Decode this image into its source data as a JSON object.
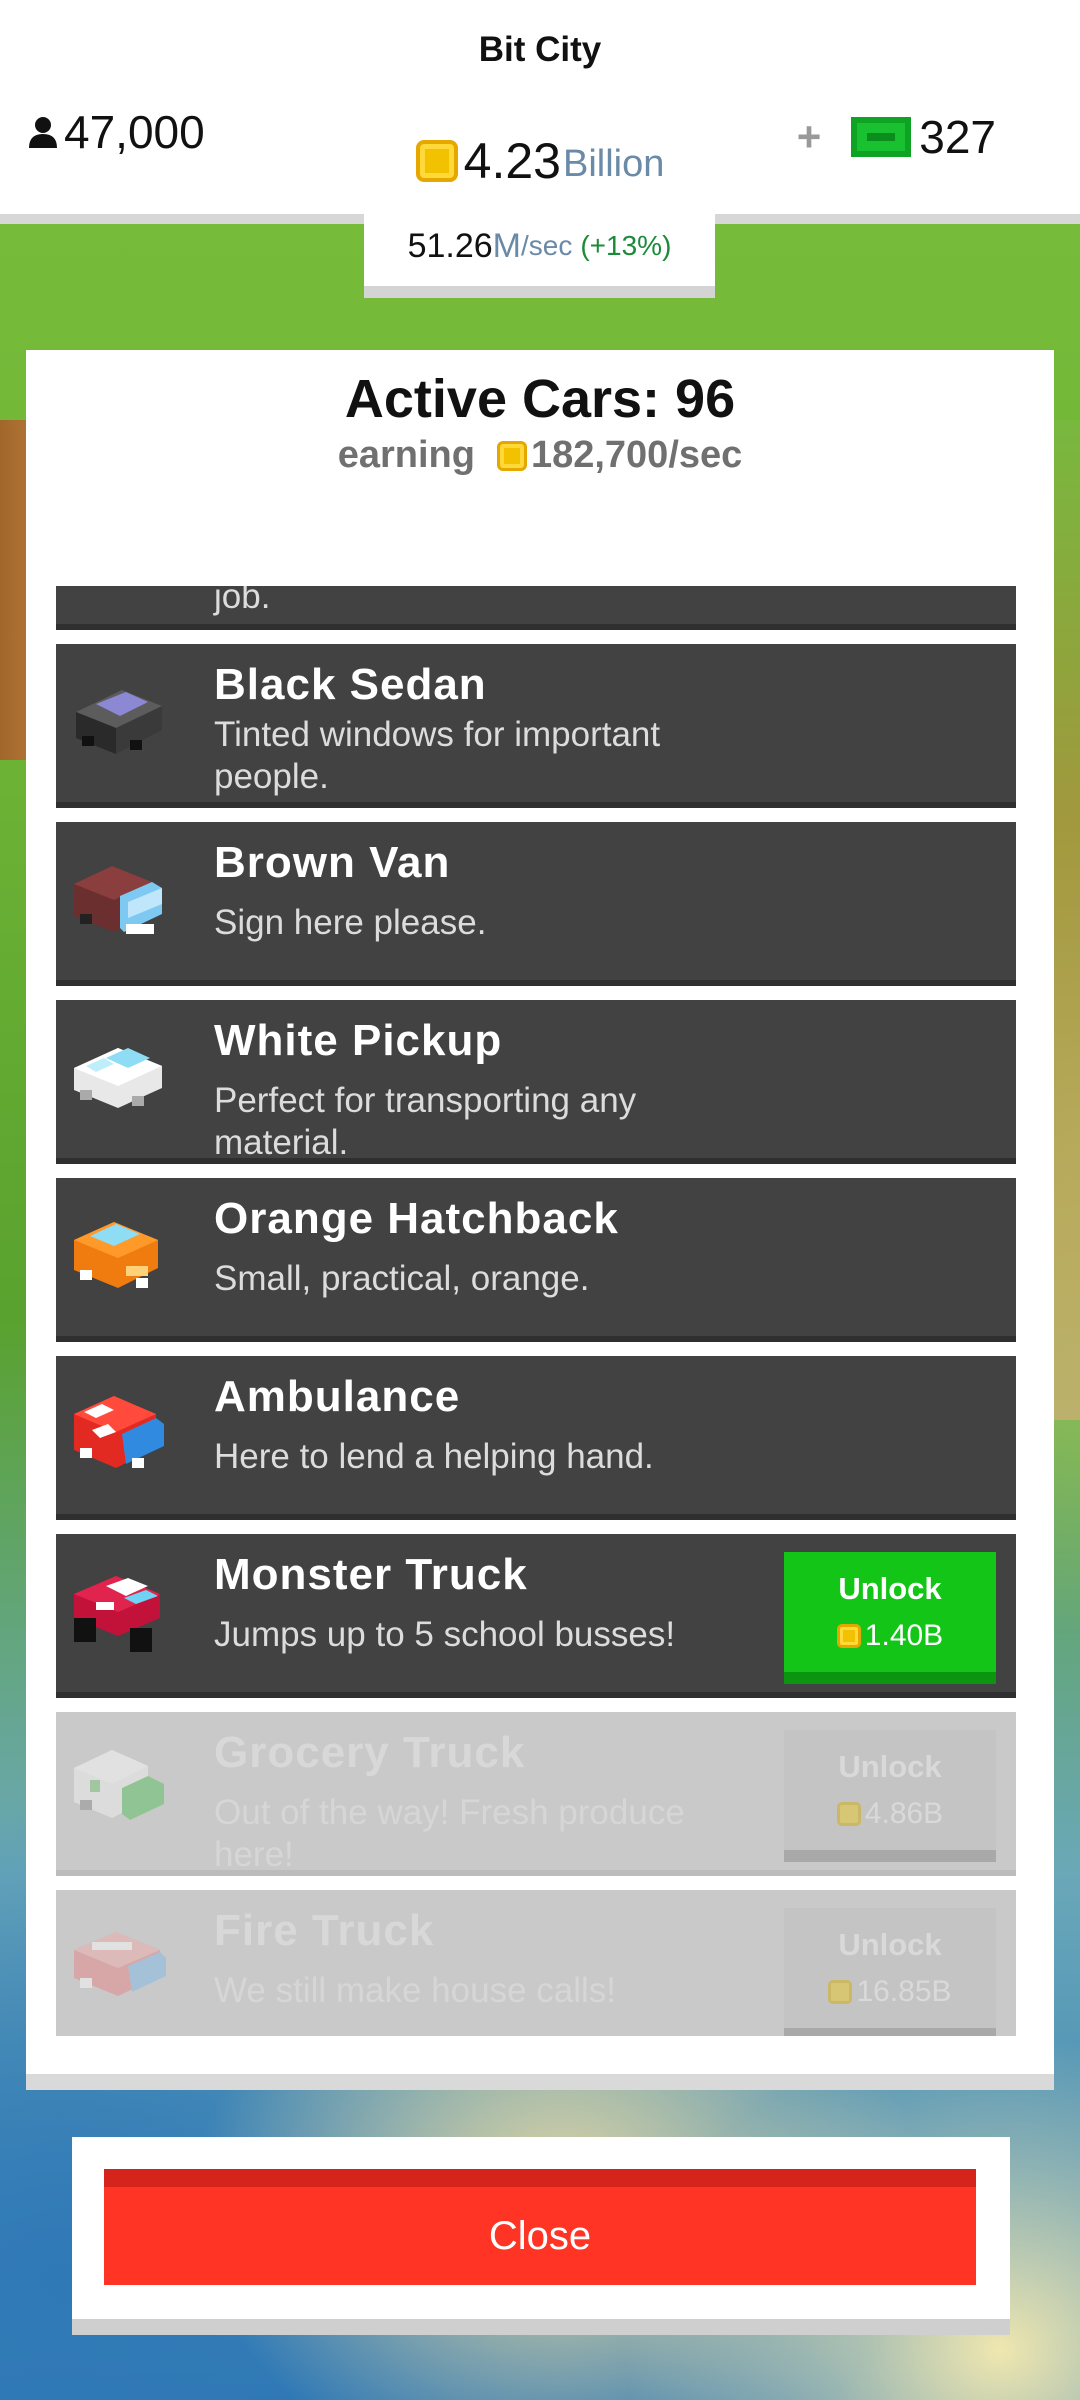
{
  "header": {
    "city_name": "Bit City",
    "population": "47,000",
    "coins_value": "4.23",
    "coins_unit": "Billion",
    "cash_plus": "+",
    "cash_value": "327",
    "rate_value": "51.26",
    "rate_unit_m": "M",
    "rate_unit_sec": "/sec",
    "rate_change": "(+13%)"
  },
  "panel": {
    "title": "Active Cars: 96",
    "earning_label": "earning",
    "earning_value": "182,700/sec"
  },
  "cars": [
    {
      "name": "",
      "desc": "job.",
      "icon": "partial-car-icon"
    },
    {
      "name": "Black Sedan",
      "desc": "Tinted windows for important people.",
      "icon": "black-sedan-icon"
    },
    {
      "name": "Brown Van",
      "desc": "Sign here please.",
      "icon": "brown-van-icon"
    },
    {
      "name": "White Pickup",
      "desc": "Perfect for transporting any material.",
      "icon": "white-pickup-icon"
    },
    {
      "name": "Orange Hatchback",
      "desc": "Small, practical, orange.",
      "icon": "orange-hatchback-icon"
    },
    {
      "name": "Ambulance",
      "desc": "Here to lend a helping hand.",
      "icon": "ambulance-icon"
    },
    {
      "name": "Monster Truck",
      "desc": "Jumps up to 5 school busses!",
      "icon": "monster-truck-icon",
      "unlock_label": "Unlock",
      "price": "1.40B"
    },
    {
      "name": "Grocery Truck",
      "desc": "Out of the way! Fresh produce here!",
      "icon": "grocery-truck-icon",
      "unlock_label": "Unlock",
      "price": "4.86B"
    },
    {
      "name": "Fire Truck",
      "desc": "We still make house calls!",
      "icon": "fire-truck-icon",
      "unlock_label": "Unlock",
      "price": "16.85B"
    }
  ],
  "close_label": "Close",
  "colors": {
    "unlock_green": "#12c517",
    "close_red": "#ff3424",
    "card_dark": "#424242",
    "rate_green": "#1b8b3a",
    "unit_blue": "#6a8aa8"
  }
}
